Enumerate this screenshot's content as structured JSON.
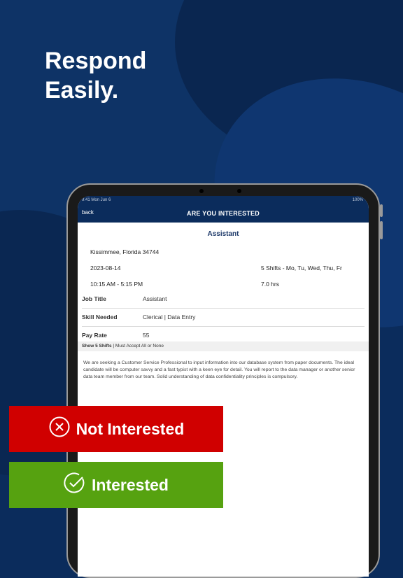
{
  "headline": {
    "line1": "Respond",
    "line2": "Easily."
  },
  "device": {
    "status_time": "9:41  Mon Jun 6",
    "status_battery": "100%",
    "nav": {
      "back_label": "back",
      "title": "ARE YOU INTERESTED"
    },
    "job": {
      "title": "Assistant",
      "location": "Kissimmee, Florida 34744",
      "date": "2023-08-14",
      "shifts_summary": "5 Shifts - Mo, Tu, Wed, Thu, Fr",
      "time_range": "10:15 AM - 5:15 PM",
      "hours": "7.0 hrs",
      "details": [
        {
          "label": "Job Title",
          "value": "Assistant"
        },
        {
          "label": "Skill Needed",
          "value": "Clerical | Data Entry"
        },
        {
          "label": "Pay Rate",
          "value": "55"
        }
      ],
      "shifts_link": "Show 5 Shifts",
      "shifts_rule": " | Must Accept All or None",
      "description": "We are seeking a Customer Service Professional to input information into our database system from paper documents. The ideal candidate will be computer savvy and a fast typist with a keen eye for detail. You will report to the data manager or another senior data team member from our team. Solid understanding of data confidentiality principles is compulsory."
    }
  },
  "buttons": {
    "not_interested": {
      "label": "Not Interested",
      "color": "#d00000",
      "icon": "x-circle-icon"
    },
    "interested": {
      "label": "Interested",
      "color": "#56a210",
      "icon": "check-circle-icon"
    }
  },
  "colors": {
    "navy": "#0b2c5c",
    "accent_text": "#1e3a6a"
  }
}
